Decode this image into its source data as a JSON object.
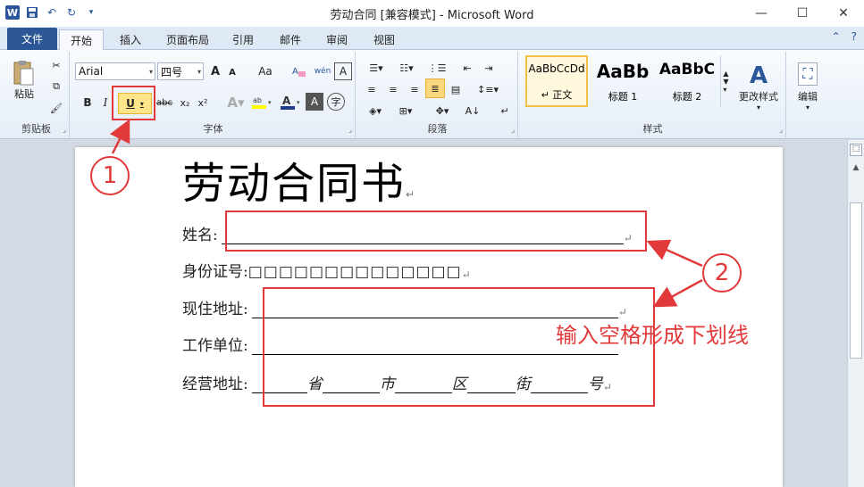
{
  "window": {
    "title": "劳动合同 [兼容模式] - Microsoft Word",
    "app_icon": "W",
    "qat_icons": [
      "save-icon",
      "undo-icon",
      "redo-icon",
      "customize-icon"
    ]
  },
  "tabs": [
    "文件",
    "开始",
    "插入",
    "页面布局",
    "引用",
    "邮件",
    "审阅",
    "视图"
  ],
  "ribbon": {
    "clipboard": {
      "label": "剪贴板",
      "paste": "粘贴"
    },
    "font": {
      "label": "字体",
      "font_name": "Arial",
      "font_size": "四号",
      "grow": "A",
      "shrink": "A",
      "change_case": "Aa",
      "bold": "B",
      "italic": "I",
      "underline": "U",
      "strike": "abc",
      "subscript": "x₂",
      "superscript": "x²",
      "color_a": "A"
    },
    "paragraph": {
      "label": "段落"
    },
    "styles": {
      "label": "样式",
      "items": [
        {
          "preview": "AaBbCcDd",
          "name": "↵ 正文"
        },
        {
          "preview": "AaBb",
          "name": "标题 1"
        },
        {
          "preview": "AaBbC",
          "name": "标题 2"
        }
      ],
      "change_styles": "更改样式"
    },
    "editing": {
      "label": "编辑"
    }
  },
  "document": {
    "title": "劳动合同书",
    "name_label": "姓名:",
    "id_label": "身份证号:",
    "id_boxes": "□□□□□□□□□□□□□□",
    "address_label": "现住地址:",
    "work_label": "工作单位:",
    "business_label": "经营地址:",
    "addr_parts": [
      "省",
      "市",
      "区",
      "街",
      "号"
    ],
    "para_mark": "↵"
  },
  "annotations": {
    "num1": "1",
    "num2": "2",
    "note": "输入空格形成下划线",
    "color": "#e23a3a"
  }
}
